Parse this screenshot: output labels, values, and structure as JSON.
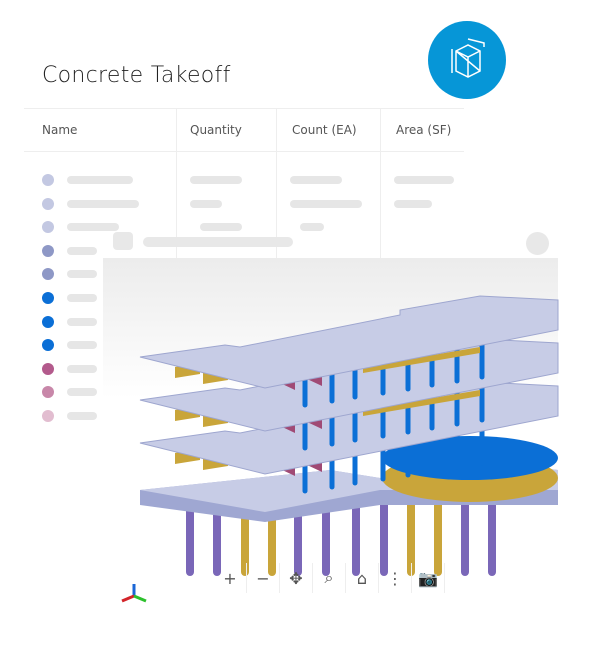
{
  "title": "Concrete Takeoff",
  "badge_icon": "3d-box-icon",
  "table": {
    "columns": [
      "Name",
      "Quantity",
      "Count (EA)",
      "Area (SF)"
    ],
    "row_colors": [
      "#c3c8e2",
      "#c3c8e2",
      "#c3c8e2",
      "#8e98c6",
      "#8e98c6",
      "#0b6fd6",
      "#0b6fd6",
      "#0b6fd6",
      "#b35a8c",
      "#c887a9",
      "#e2bdd0"
    ]
  },
  "viewer": {
    "toolbar": [
      {
        "icon": "zoom-in-icon",
        "glyph": "+"
      },
      {
        "icon": "zoom-out-icon",
        "glyph": "−"
      },
      {
        "icon": "pan-icon",
        "glyph": "✥"
      },
      {
        "icon": "zoom-window-icon",
        "glyph": "⌕"
      },
      {
        "icon": "home-icon",
        "glyph": "⌂"
      },
      {
        "icon": "more-icon",
        "glyph": "⋮"
      },
      {
        "icon": "camera-icon",
        "glyph": "📷"
      }
    ]
  },
  "colors": {
    "slab": "#c7cce6",
    "column_blue": "#0b6fd6",
    "column_purple": "#7a67b8",
    "beam_gold": "#c9a53a",
    "beam_magenta": "#a04a75",
    "accent": "#0696d7"
  }
}
